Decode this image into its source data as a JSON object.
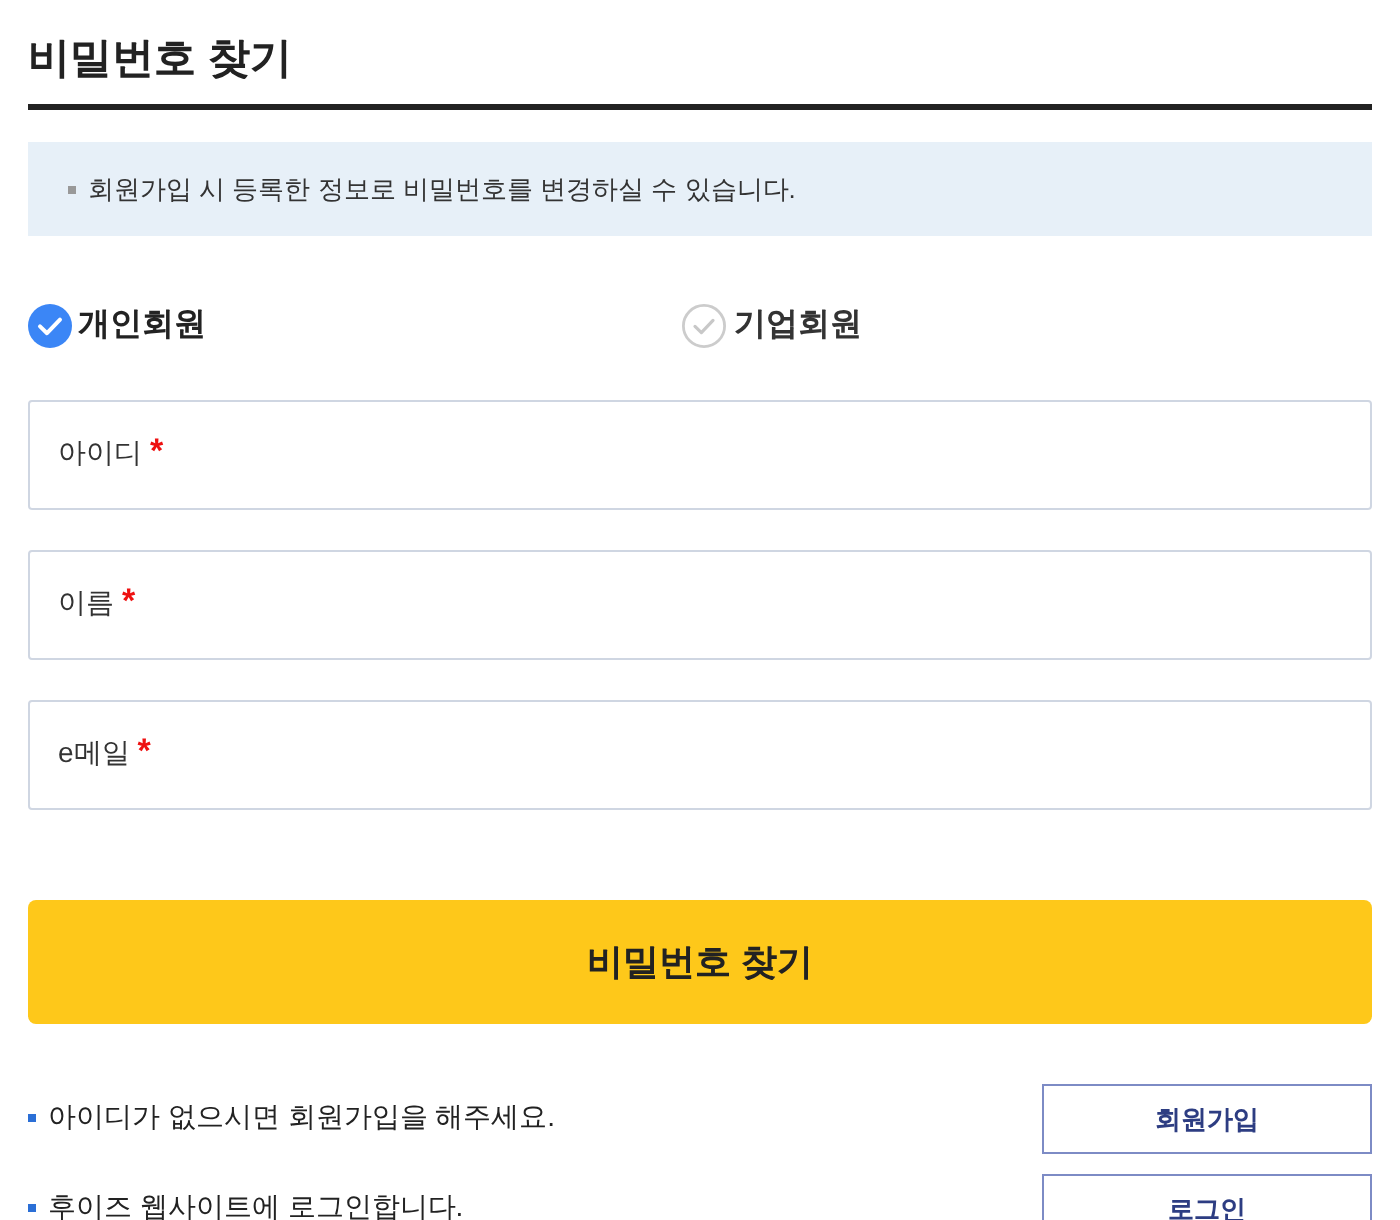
{
  "title": "비밀번호 찾기",
  "notice": {
    "text": "회원가입 시 등록한 정보로 비밀번호를 변경하실 수 있습니다."
  },
  "member_types": [
    {
      "label": "개인회원",
      "selected": true
    },
    {
      "label": "기업회원",
      "selected": false
    }
  ],
  "fields": [
    {
      "label": "아이디",
      "required_mark": "*"
    },
    {
      "label": "이름",
      "required_mark": "*"
    },
    {
      "label": "e메일",
      "required_mark": "*"
    }
  ],
  "submit_button": "비밀번호 찾기",
  "help_rows": [
    {
      "text": "아이디가 없으시면 회원가입을 해주세요.",
      "button": "회원가입"
    },
    {
      "text": "후이즈 웹사이트에 로그인합니다.",
      "button": "로그인"
    }
  ]
}
